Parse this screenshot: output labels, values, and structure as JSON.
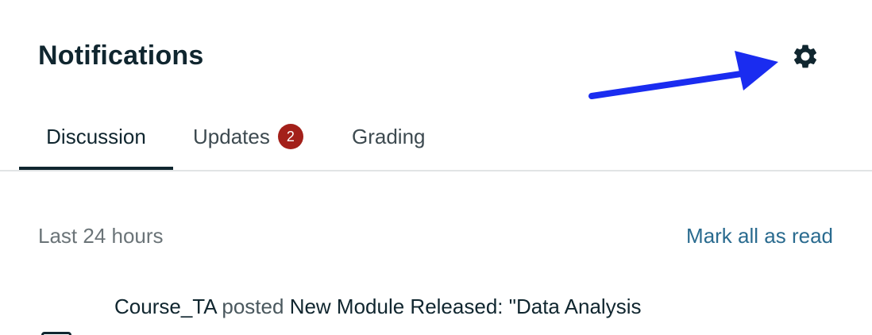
{
  "header": {
    "title": "Notifications",
    "settings_icon": "gear-icon"
  },
  "tabs": [
    {
      "label": "Discussion",
      "active": true
    },
    {
      "label": "Updates",
      "badge": "2",
      "active": false
    },
    {
      "label": "Grading",
      "active": false
    }
  ],
  "section": {
    "label": "Last 24 hours",
    "mark_all_read": "Mark all as read"
  },
  "notifications": [
    {
      "author": "Course_TA",
      "verb": "posted",
      "subject": "New Module Released: \"Data Analysis"
    }
  ],
  "colors": {
    "text_primary": "#10262f",
    "link": "#2a6b8f",
    "badge": "#a3201a",
    "annotation_arrow": "#1a2cf0"
  }
}
